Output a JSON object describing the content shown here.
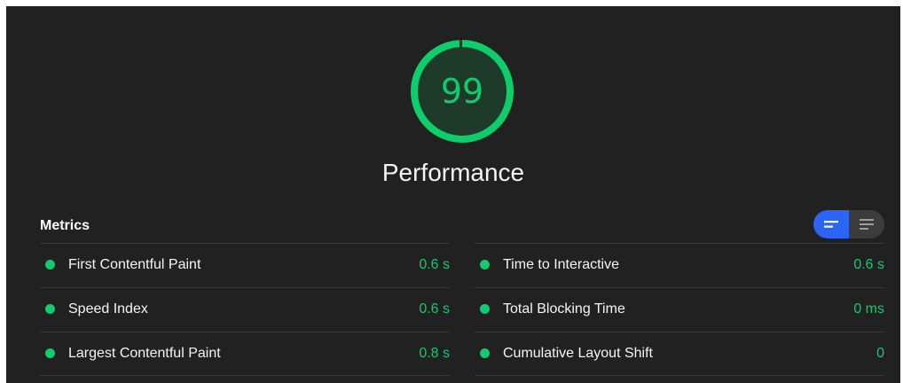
{
  "score": {
    "value": "99",
    "fraction": 0.99,
    "label": "Performance",
    "color": "#0cce6b"
  },
  "metrics": {
    "title": "Metrics",
    "toggle": {
      "active_icon": "summary-view-icon",
      "inactive_icon": "detail-view-icon",
      "active_color": "#2a65f5"
    },
    "left": [
      {
        "name": "First Contentful Paint",
        "value": "0.6 s"
      },
      {
        "name": "Speed Index",
        "value": "0.6 s"
      },
      {
        "name": "Largest Contentful Paint",
        "value": "0.8 s"
      }
    ],
    "right": [
      {
        "name": "Time to Interactive",
        "value": "0.6 s"
      },
      {
        "name": "Total Blocking Time",
        "value": "0 ms"
      },
      {
        "name": "Cumulative Layout Shift",
        "value": "0"
      }
    ]
  },
  "colors": {
    "background": "#212121",
    "pass": "#0cce6b",
    "text": "#f5f5f5"
  }
}
